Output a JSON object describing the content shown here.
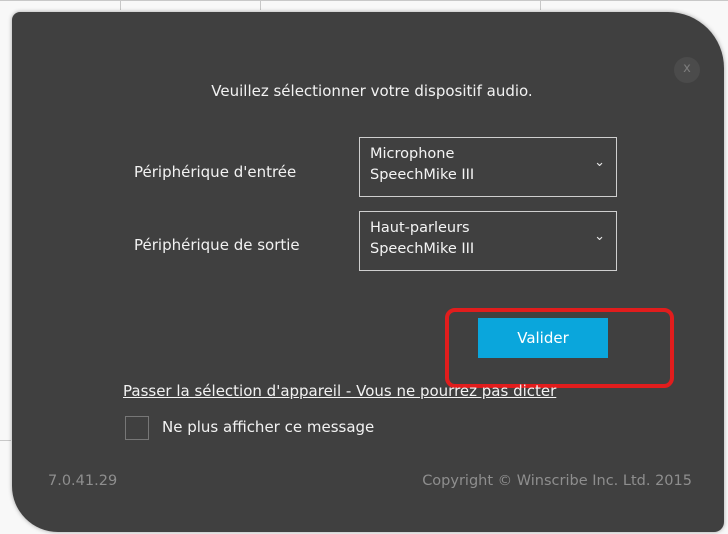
{
  "dialog": {
    "close_glyph": "x",
    "instruction": "Veuillez sélectionner votre dispositif audio.",
    "input": {
      "label": "Périphérique d'entrée",
      "selected": "Microphone\nSpeechMike III",
      "icon": "chevron-down-icon"
    },
    "output": {
      "label": "Périphérique de sortie",
      "selected": "Haut-parleurs\nSpeechMike III",
      "icon": "chevron-down-icon"
    },
    "validate_label": "Valider",
    "skip_link": "Passer la sélection d'appareil - Vous ne pourrez pas dicter",
    "dont_show_label": "Ne plus afficher ce message",
    "dont_show_checked": false,
    "version": "7.0.41.29",
    "copyright": "Copyright © Winscribe Inc. Ltd. 2015"
  },
  "colors": {
    "dialog_bg": "#404040",
    "accent": "#0aa6dc",
    "annotation": "#e11d1d",
    "footer_text": "#8e8e8e"
  }
}
